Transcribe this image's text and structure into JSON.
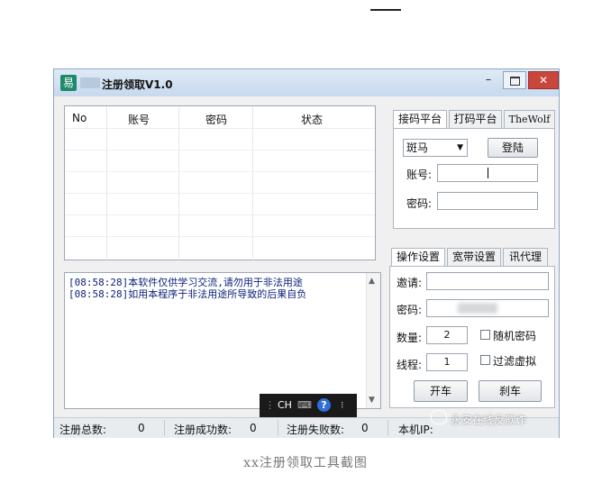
{
  "window": {
    "title": "注册领取V1.0",
    "icon_glyph": "易",
    "minimize_glyph": "–",
    "close_glyph": "✕",
    "accent_color": "#c9463d"
  },
  "accounts_table": {
    "columns": [
      "No",
      "账号",
      "密码",
      "状态"
    ]
  },
  "log": {
    "lines": [
      "[08:58:28]本软件仅供学习交流,请勿用于非法用途",
      "[08:58:28]如用本程序于非法用途所导致的后果自负"
    ]
  },
  "ime_bar": {
    "mode": "CH",
    "help": "?"
  },
  "platform_tabs": [
    "接码平台",
    "打码平台",
    "TheWolf"
  ],
  "platform": {
    "provider_selected": "斑马",
    "login_button": "登陆",
    "account_label": "账号:",
    "password_label": "密码:"
  },
  "settings_tabs": [
    "操作设置",
    "宽带设置",
    "讯代理"
  ],
  "settings": {
    "invite_label": "邀请:",
    "password_label": "密码:",
    "quantity_label": "数量:",
    "quantity_value": "2",
    "random_password_label": "随机密码",
    "threads_label": "线程:",
    "threads_value": "1",
    "filter_virtual_label": "过滤虚拟",
    "start_button": "开车",
    "stop_button": "刹车"
  },
  "status_bar": {
    "total_label": "注册总数:",
    "total_value": "0",
    "success_label": "注册成功数:",
    "success_value": "0",
    "fail_label": "注册失败数:",
    "fail_value": "0",
    "ip_label": "本机IP:"
  },
  "watermark": "永安在线反欺诈",
  "caption": "xx注册领取工具截图"
}
